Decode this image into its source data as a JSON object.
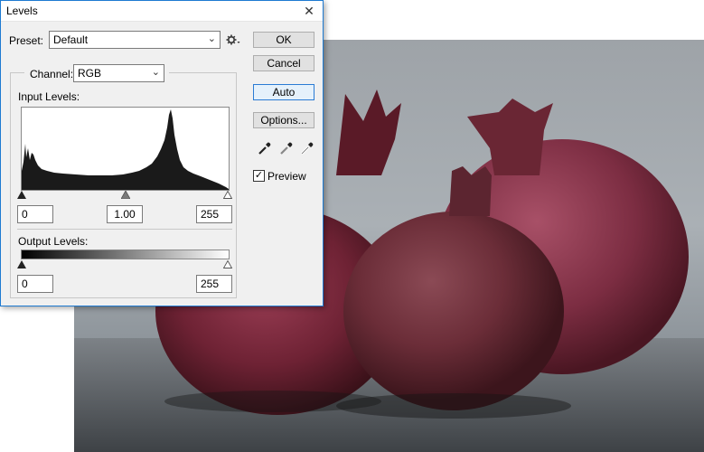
{
  "window": {
    "title": "Levels",
    "close_glyph": "✕"
  },
  "preset": {
    "label": "Preset:",
    "value": "Default"
  },
  "channel": {
    "label": "Channel:",
    "value": "RGB"
  },
  "input_levels": {
    "label": "Input Levels:",
    "black": "0",
    "gamma": "1.00",
    "white": "255"
  },
  "output_levels": {
    "label": "Output Levels:",
    "black": "0",
    "white": "255"
  },
  "buttons": {
    "ok": "OK",
    "cancel": "Cancel",
    "auto": "Auto",
    "options": "Options..."
  },
  "preview": {
    "label": "Preview",
    "checked": true,
    "check_glyph": "✓"
  },
  "icons": {
    "preset_menu": "gear-icon",
    "black_eyedropper": "eyedropper-black-icon",
    "gray_eyedropper": "eyedropper-gray-icon",
    "white_eyedropper": "eyedropper-white-icon",
    "dropdown": "chevron-down-icon"
  },
  "colors": {
    "dialog_border": "#1e7ad1",
    "default_button": "#e5f1fb",
    "histogram_fill": "#1a1a1a"
  }
}
